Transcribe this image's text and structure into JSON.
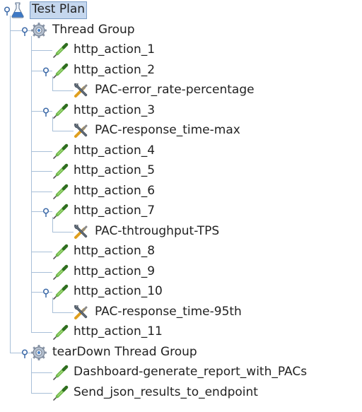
{
  "tree": {
    "root": {
      "label": "Test Plan",
      "icon": "flask-icon",
      "selected": true,
      "expanded": true
    },
    "groups": [
      {
        "label": "Thread Group",
        "icon": "gear-icon",
        "expanded": true,
        "children": [
          {
            "label": "http_action_1",
            "icon": "pipette-icon"
          },
          {
            "label": "http_action_2",
            "icon": "pipette-icon",
            "expanded": true,
            "children": [
              {
                "label": "PAC-error_rate-percentage",
                "icon": "tools-icon"
              }
            ]
          },
          {
            "label": "http_action_3",
            "icon": "pipette-icon",
            "expanded": true,
            "children": [
              {
                "label": "PAC-response_time-max",
                "icon": "tools-icon"
              }
            ]
          },
          {
            "label": "http_action_4",
            "icon": "pipette-icon"
          },
          {
            "label": "http_action_5",
            "icon": "pipette-icon"
          },
          {
            "label": "http_action_6",
            "icon": "pipette-icon"
          },
          {
            "label": "http_action_7",
            "icon": "pipette-icon",
            "expanded": true,
            "children": [
              {
                "label": "PAC-thtroughput-TPS",
                "icon": "tools-icon"
              }
            ]
          },
          {
            "label": "http_action_8",
            "icon": "pipette-icon"
          },
          {
            "label": "http_action_9",
            "icon": "pipette-icon"
          },
          {
            "label": "http_action_10",
            "icon": "pipette-icon",
            "expanded": true,
            "children": [
              {
                "label": "PAC-response_time-95th",
                "icon": "tools-icon"
              }
            ]
          },
          {
            "label": "http_action_11",
            "icon": "pipette-icon"
          }
        ]
      },
      {
        "label": "tearDown Thread Group",
        "icon": "gear-icon",
        "expanded": true,
        "children": [
          {
            "label": "Dashboard-generate_report_with_PACs",
            "icon": "pipette-icon"
          },
          {
            "label": "Send_json_results_to_endpoint",
            "icon": "pipette-icon"
          }
        ]
      }
    ]
  }
}
